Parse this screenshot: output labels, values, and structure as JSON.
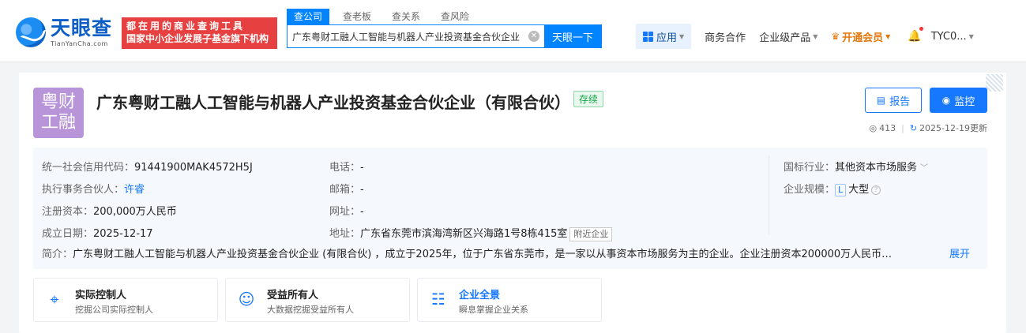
{
  "header": {
    "logo_cn": "天眼查",
    "logo_en": "TianYanCha.com",
    "slogan_line1": "都在用的商业查询工具",
    "slogan_line2": "国家中小企业发展子基金旗下机构",
    "search_tabs": [
      {
        "label": "查公司",
        "active": true
      },
      {
        "label": "查老板",
        "active": false
      },
      {
        "label": "查关系",
        "active": false
      },
      {
        "label": "查风险",
        "active": false
      }
    ],
    "search_value": "广东粤财工融人工智能与机器人产业投资基金合伙企业",
    "search_button": "天眼一下",
    "nav": {
      "apps": "应用",
      "business": "商务合作",
      "enterprise": "企业级产品",
      "vip": "开通会员",
      "user": "TYC0..."
    }
  },
  "company": {
    "logo_text_1": "粤财",
    "logo_text_2": "工融",
    "logo_color": "#b894d8",
    "name": "广东粤财工融人工智能与机器人产业投资基金合伙企业（有限合伙）",
    "status": "存续",
    "report_button": "报告",
    "monitor_button": "监控",
    "views": "413",
    "updated": "2025-12-19更新"
  },
  "info": {
    "credit_code_label": "统一社会信用代码：",
    "credit_code": "91441900MAK4572H5J",
    "partner_label": "执行事务合伙人：",
    "partner": "许睿",
    "capital_label": "注册资本：",
    "capital": "200,000万人民币",
    "founded_label": "成立日期：",
    "founded": "2025-12-17",
    "phone_label": "电话：",
    "phone": "-",
    "email_label": "邮箱：",
    "email": "-",
    "website_label": "网址：",
    "website": "-",
    "address_label": "地址：",
    "address": "广东省东莞市滨海湾新区兴海路1号8栋415室",
    "nearby_tag": "附近企业",
    "industry_label": "国标行业：",
    "industry": "其他资本市场服务",
    "scale_label": "企业规模：",
    "scale_badge": "L",
    "scale": "大型",
    "intro_label": "简介：",
    "intro": "广东粤财工融人工智能与机器人产业投资基金合伙企业 (有限合伙) ，成立于2025年，位于广东省东莞市，是一家以从事资本市场服务为主的企业。企业注册资本200000万人民币…",
    "expand": "展开"
  },
  "features": [
    {
      "title": "实际控制人",
      "sub": "挖掘公司实际控制人",
      "icon": "target-icon"
    },
    {
      "title": "受益所有人",
      "sub": "大数据挖掘受益所有人",
      "icon": "beneficiary-icon"
    },
    {
      "title": "企业全景",
      "sub": "瞬息掌握企业关系",
      "icon": "org-chart-icon"
    }
  ],
  "colors": {
    "primary": "#1677ff",
    "brand_red": "#e64040",
    "status_green": "#12a344",
    "vip_orange": "#e5770c"
  }
}
